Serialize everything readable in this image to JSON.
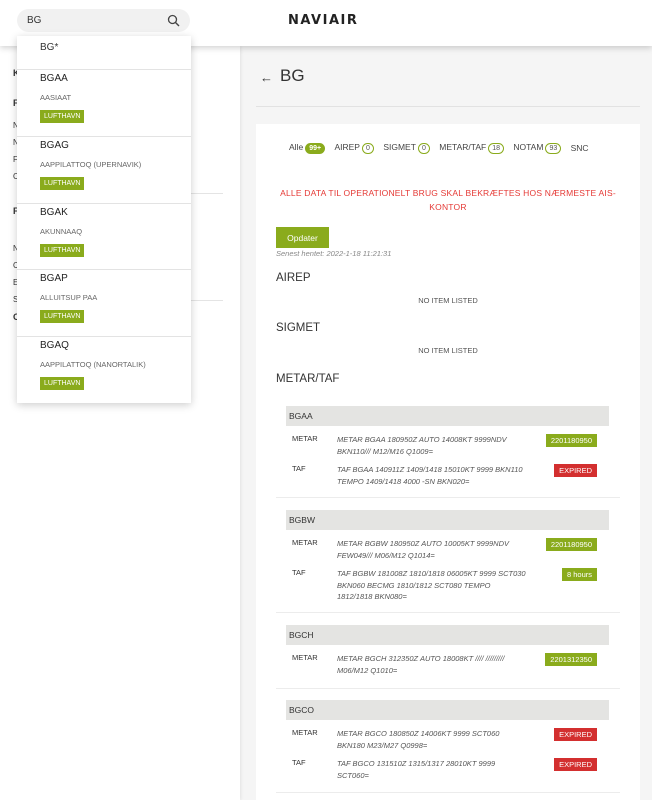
{
  "header": {
    "search_value": "BG",
    "logo": "NAVIAIR"
  },
  "dropdown": {
    "first": "BG*",
    "items": [
      {
        "code": "BGAA",
        "name": "AASIAAT",
        "badge": "LUFTHAVN"
      },
      {
        "code": "BGAG",
        "name": "AAPPILATTOQ (UPERNAVIK)",
        "badge": "LUFTHAVN"
      },
      {
        "code": "BGAK",
        "name": "AKUNNAAQ",
        "badge": "LUFTHAVN"
      },
      {
        "code": "BGAP",
        "name": "ALLUITSUP PAA",
        "badge": "LUFTHAVN"
      },
      {
        "code": "BGAQ",
        "name": "AAPPILATTOQ (NANORTALIK)",
        "badge": "LUFTHAVN"
      }
    ]
  },
  "sidebar": {
    "letters": [
      "K",
      "F",
      "N",
      "N",
      "F",
      "C",
      "F",
      "N",
      "C",
      "E",
      "S",
      "C"
    ]
  },
  "main": {
    "title": "BG",
    "tabs": [
      {
        "label": "Alle",
        "count": "99+"
      },
      {
        "label": "AIREP",
        "count": "0"
      },
      {
        "label": "SIGMET",
        "count": "0"
      },
      {
        "label": "METAR/TAF",
        "count": "18"
      },
      {
        "label": "NOTAM",
        "count": "93"
      },
      {
        "label": "SNC",
        "count": ""
      }
    ],
    "warning": "ALLE DATA TIL OPERATIONELT BRUG SKAL BEKRÆFTES HOS NÆRMESTE AIS-KONTOR",
    "update_label": "Opdater",
    "last_fetched": "Senest hentet: 2022-1-18 11:21:31",
    "sections": {
      "airep": {
        "title": "AIREP",
        "empty": "NO ITEM LISTED"
      },
      "sigmet": {
        "title": "SIGMET",
        "empty": "NO ITEM LISTED"
      },
      "metar": {
        "title": "METAR/TAF"
      }
    },
    "stations": [
      {
        "code": "BGAA",
        "rows": [
          {
            "type": "METAR",
            "text": "METAR BGAA 180950Z AUTO 14008KT 9999NDV BKN110/// M12/M16 Q1009=",
            "badge": "2201180950",
            "status": "green"
          },
          {
            "type": "TAF",
            "text": "TAF BGAA 140911Z 1409/1418 15010KT 9999 BKN110 TEMPO 1409/1418 4000 -SN BKN020=",
            "badge": "EXPIRED",
            "status": "red"
          }
        ]
      },
      {
        "code": "BGBW",
        "rows": [
          {
            "type": "METAR",
            "text": "METAR BGBW 180950Z AUTO 10005KT 9999NDV FEW049/// M06/M12 Q1014=",
            "badge": "2201180950",
            "status": "green"
          },
          {
            "type": "TAF",
            "text": "TAF BGBW 181008Z 1810/1818 06005KT 9999 SCT030 BKN060 BECMG 1810/1812 SCT080 TEMPO 1812/1818 BKN080=",
            "badge": "8 hours",
            "status": "green"
          }
        ]
      },
      {
        "code": "BGCH",
        "rows": [
          {
            "type": "METAR",
            "text": "METAR BGCH 312350Z AUTO 18008KT //// ///////// M06/M12 Q1010=",
            "badge": "2201312350",
            "status": "green"
          }
        ]
      },
      {
        "code": "BGCO",
        "rows": [
          {
            "type": "METAR",
            "text": "METAR BGCO 180850Z 14006KT 9999 SCT060 BKN180 M23/M27 Q0998=",
            "badge": "EXPIRED",
            "status": "red"
          },
          {
            "type": "TAF",
            "text": "TAF BGCO 131510Z 1315/1317 28010KT 9999 SCT060=",
            "badge": "EXPIRED",
            "status": "red"
          }
        ]
      }
    ]
  }
}
